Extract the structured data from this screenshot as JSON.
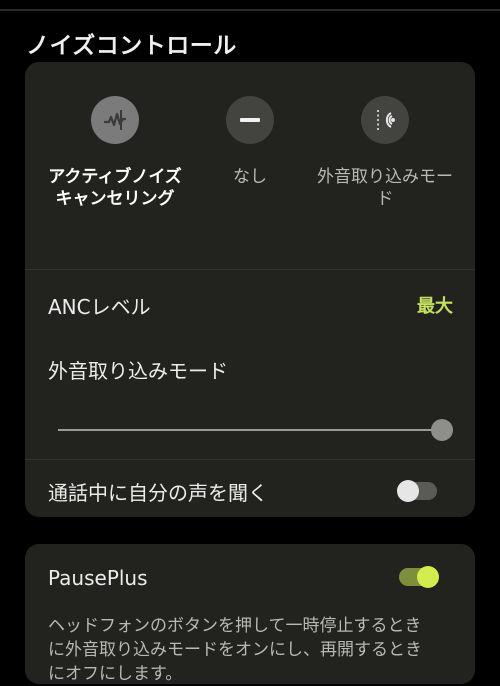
{
  "section": {
    "title": "ノイズコントロール"
  },
  "modes": [
    {
      "label": "アクティブノイズキャンセリング",
      "icon": "anc-waveform-icon",
      "selected": true
    },
    {
      "label": "なし",
      "icon": "minus-icon",
      "selected": false
    },
    {
      "label": "外音取り込みモード",
      "icon": "ambient-sound-icon",
      "selected": false
    }
  ],
  "anc_level": {
    "label": "ANCレベル",
    "value": "最大"
  },
  "ambient_mode": {
    "label": "外音取り込みモード",
    "slider_value": 1.0
  },
  "hear_own_voice": {
    "label": "通話中に自分の声を聞く",
    "enabled": false
  },
  "pause_plus": {
    "label": "PausePlus",
    "enabled": true,
    "description": "ヘッドフォンのボタンを押して一時停止するときに外音取り込みモードをオンにし、再開するときにオフにします。"
  },
  "colors": {
    "accent": "#c5e05f",
    "card_bg": "#22221f",
    "page_bg": "#000000"
  }
}
